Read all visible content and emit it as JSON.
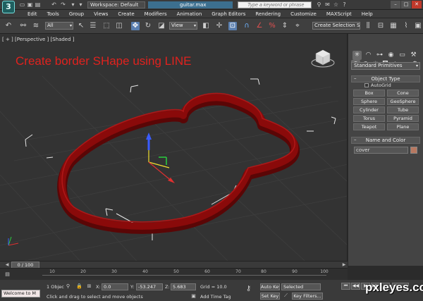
{
  "titlebar": {
    "logo": "3",
    "workspace": "Workspace: Default",
    "filename": "guitar.max",
    "search_placeholder": "Type a keyword or phrase",
    "win_min": "–",
    "win_max": "□",
    "win_close": "✕"
  },
  "menu": [
    "Edit",
    "Tools",
    "Group",
    "Views",
    "Create",
    "Modifiers",
    "Animation",
    "Graph Editors",
    "Rendering",
    "Customize",
    "MAXScript",
    "Help"
  ],
  "toolbar": {
    "filter_select": "All",
    "ref_coord_select": "View",
    "selection_set": "Create Selection Se"
  },
  "viewport": {
    "label": "[ + ] [Perspective ] [Shaded ]",
    "annotation": "Create border SHape using LINE"
  },
  "panel": {
    "primitives_select": "Standard Primitives",
    "object_type_header": "Object Type",
    "autogrid": "AutoGrid",
    "objects": [
      "Box",
      "Cone",
      "Sphere",
      "GeoSphere",
      "Cylinder",
      "Tube",
      "Torus",
      "Pyramid",
      "Teapot",
      "Plane"
    ],
    "name_color_header": "Name and Color",
    "object_name": "cover",
    "object_color": "#b87860"
  },
  "timeslider": {
    "label": "0 / 100"
  },
  "trackbar": {
    "ticks": [
      "10",
      "20",
      "30",
      "40",
      "50",
      "60",
      "70",
      "80",
      "90",
      "100"
    ]
  },
  "status": {
    "maxscript": "Welcome to M",
    "selection_count": "1 Objec",
    "prompt": "Click and drag to select and move objects",
    "x_label": "X:",
    "x_value": "0.0",
    "y_label": "Y:",
    "y_value": "-53.247",
    "z_label": "Z:",
    "z_value": "5.683",
    "grid": "Grid = 10.0",
    "add_time_tag": "Add Time Tag",
    "auto_key": "Auto Key",
    "auto_key_mode": "Selected",
    "set_key": "Set Key",
    "key_filters": "Key Filters...",
    "frame": "0"
  },
  "watermark": "pxleyes.com",
  "colors": {
    "guitar_body": "#8a0a0a",
    "title_red": "#e0221e",
    "accent_blue": "#5a7fb0"
  }
}
